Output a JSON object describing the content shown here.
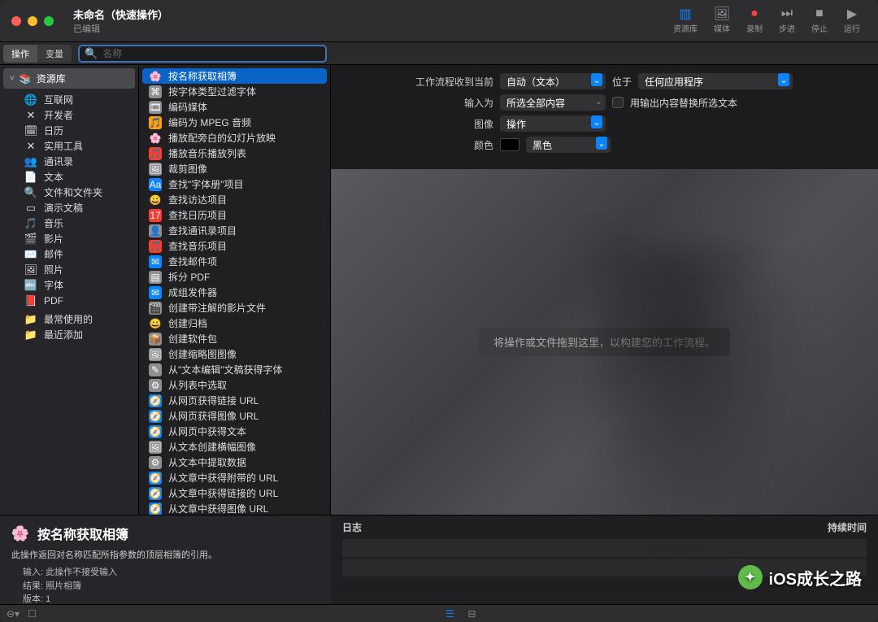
{
  "title": {
    "main": "未命名（快速操作）",
    "sub": "已编辑"
  },
  "toolbar": {
    "library": "资源库",
    "media": "媒体",
    "record": "录制",
    "step": "步进",
    "stop": "停止",
    "run": "运行"
  },
  "segment": {
    "actions": "操作",
    "variables": "变量"
  },
  "search": {
    "placeholder": "名称"
  },
  "sidebar": {
    "root": "资源库",
    "items": [
      {
        "label": "互联网",
        "icon": "🌐",
        "cls": ""
      },
      {
        "label": "开发者",
        "icon": "✕",
        "cls": ""
      },
      {
        "label": "日历",
        "icon": "🗓",
        "cls": ""
      },
      {
        "label": "实用工具",
        "icon": "✕",
        "cls": ""
      },
      {
        "label": "通讯录",
        "icon": "👥",
        "cls": ""
      },
      {
        "label": "文本",
        "icon": "📄",
        "cls": ""
      },
      {
        "label": "文件和文件夹",
        "icon": "🔍",
        "cls": ""
      },
      {
        "label": "演示文稿",
        "icon": "▭",
        "cls": ""
      },
      {
        "label": "音乐",
        "icon": "🎵",
        "cls": ""
      },
      {
        "label": "影片",
        "icon": "🎬",
        "cls": ""
      },
      {
        "label": "邮件",
        "icon": "✉️",
        "cls": ""
      },
      {
        "label": "照片",
        "icon": "🖼",
        "cls": ""
      },
      {
        "label": "字体",
        "icon": "🔤",
        "cls": ""
      },
      {
        "label": "PDF",
        "icon": "📕",
        "cls": ""
      }
    ],
    "smart": [
      {
        "label": "最常使用的",
        "icon": "📁",
        "cls": "purple"
      },
      {
        "label": "最近添加",
        "icon": "📁",
        "cls": "purple"
      }
    ]
  },
  "actions": [
    {
      "label": "按名称获取相簿",
      "icon": "🌸",
      "cls": "",
      "selected": true
    },
    {
      "label": "按字体类型过滤字体",
      "icon": "⌘",
      "cls": "bg-gray"
    },
    {
      "label": "编码媒体",
      "icon": "🎞",
      "cls": "bg-gray"
    },
    {
      "label": "编码为 MPEG 音频",
      "icon": "🎵",
      "cls": "bg-orange"
    },
    {
      "label": "播放配旁白的幻灯片放映",
      "icon": "🌸",
      "cls": ""
    },
    {
      "label": "播放音乐播放列表",
      "icon": "🎵",
      "cls": "bg-red"
    },
    {
      "label": "裁剪图像",
      "icon": "🖼",
      "cls": "bg-gray"
    },
    {
      "label": "查找\"字体册\"项目",
      "icon": "Aa",
      "cls": "bg-blue"
    },
    {
      "label": "查找访达项目",
      "icon": "😀",
      "cls": ""
    },
    {
      "label": "查找日历项目",
      "icon": "17",
      "cls": "bg-red"
    },
    {
      "label": "查找通讯录项目",
      "icon": "👤",
      "cls": "bg-gray"
    },
    {
      "label": "查找音乐项目",
      "icon": "🎵",
      "cls": "bg-red"
    },
    {
      "label": "查找邮件项",
      "icon": "✉",
      "cls": "bg-blue"
    },
    {
      "label": "拆分 PDF",
      "icon": "▤",
      "cls": "bg-gray"
    },
    {
      "label": "成组发件器",
      "icon": "✉",
      "cls": "bg-blue"
    },
    {
      "label": "创建带注解的影片文件",
      "icon": "🎬",
      "cls": "bg-gray"
    },
    {
      "label": "创建归档",
      "icon": "😀",
      "cls": ""
    },
    {
      "label": "创建软件包",
      "icon": "📦",
      "cls": "bg-gray"
    },
    {
      "label": "创建缩略图图像",
      "icon": "🖼",
      "cls": "bg-gray"
    },
    {
      "label": "从\"文本编辑\"文稿获得字体",
      "icon": "✎",
      "cls": "bg-gray"
    },
    {
      "label": "从列表中选取",
      "icon": "⚙",
      "cls": "bg-gray"
    },
    {
      "label": "从网页获得链接 URL",
      "icon": "🧭",
      "cls": "bg-blue"
    },
    {
      "label": "从网页获得图像 URL",
      "icon": "🧭",
      "cls": "bg-blue"
    },
    {
      "label": "从网页中获得文本",
      "icon": "🧭",
      "cls": "bg-blue"
    },
    {
      "label": "从文本创建横幅图像",
      "icon": "🖼",
      "cls": "bg-gray"
    },
    {
      "label": "从文本中提取数据",
      "icon": "⚙",
      "cls": "bg-gray"
    },
    {
      "label": "从文章中获得附带的 URL",
      "icon": "🧭",
      "cls": "bg-blue"
    },
    {
      "label": "从文章中获得链接的 URL",
      "icon": "🧭",
      "cls": "bg-blue"
    },
    {
      "label": "从文章中获得图像 URL",
      "icon": "🧭",
      "cls": "bg-blue"
    }
  ],
  "detail": {
    "title": "按名称获取相簿",
    "desc": "此操作返回对名称匹配所指参数的顶层相簿的引用。",
    "input_label": "输入:",
    "input_val": "此操作不接受输入",
    "result_label": "结果:",
    "result_val": "照片相簿",
    "version_label": "版本:",
    "version_val": "1"
  },
  "params": {
    "receives_label": "工作流程收到当前",
    "receives_val": "自动（文本）",
    "in_label": "位于",
    "in_val": "任何应用程序",
    "input_label": "输入为",
    "input_val": "所选全部内容",
    "replace_label": "用输出内容替换所选文本",
    "image_label": "图像",
    "image_val": "操作",
    "color_label": "颜色",
    "color_val": "黑色"
  },
  "canvas": {
    "placeholder": "将操作或文件拖到这里，以构建您的工作流程。"
  },
  "log": {
    "log_label": "日志",
    "duration_label": "持续时间"
  },
  "watermark": {
    "text": "iOS成长之路"
  }
}
